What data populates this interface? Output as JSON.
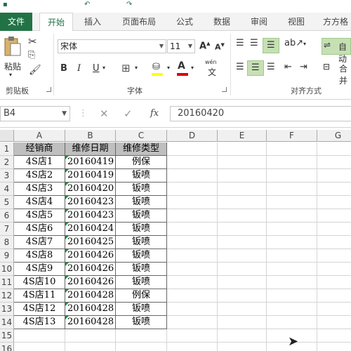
{
  "ribbon_tabs": [
    "文件",
    "开始",
    "插入",
    "页面布局",
    "公式",
    "数据",
    "审阅",
    "视图",
    "方方格"
  ],
  "active_tab": "开始",
  "clipboard": {
    "paste_label": "粘贴",
    "group_label": "剪贴板"
  },
  "font": {
    "family": "宋体",
    "size": "11",
    "group_label": "字体",
    "wen_label": "wén\n文"
  },
  "alignment": {
    "group_label": "对齐方式",
    "wrap_label": "自动",
    "merge_label": "合并"
  },
  "formula_bar": {
    "name_box": "B4",
    "fx_label": "fx",
    "content": "20160420"
  },
  "columns": [
    "A",
    "B",
    "C",
    "D",
    "E",
    "F",
    "G"
  ],
  "rows": [
    "1",
    "2",
    "3",
    "4",
    "5",
    "6",
    "7",
    "8",
    "9",
    "10",
    "11",
    "12",
    "13",
    "14",
    "15",
    "16"
  ],
  "table": {
    "headers": [
      "经销商",
      "维修日期",
      "维修类型"
    ],
    "data": [
      [
        "4S店1",
        "20160419",
        "例保"
      ],
      [
        "4S店2",
        "20160419",
        "钣喷"
      ],
      [
        "4S店3",
        "20160420",
        "钣喷"
      ],
      [
        "4S店4",
        "20160423",
        "钣喷"
      ],
      [
        "4S店5",
        "20160423",
        "钣喷"
      ],
      [
        "4S店6",
        "20160424",
        "钣喷"
      ],
      [
        "4S店7",
        "20160425",
        "钣喷"
      ],
      [
        "4S店8",
        "20160426",
        "钣喷"
      ],
      [
        "4S店9",
        "20160426",
        "钣喷"
      ],
      [
        "4S店10",
        "20160426",
        "钣喷"
      ],
      [
        "4S店11",
        "20160428",
        "例保"
      ],
      [
        "4S店12",
        "20160428",
        "钣喷"
      ],
      [
        "4S店13",
        "20160428",
        "钣喷"
      ]
    ]
  },
  "colors": {
    "excel_green": "#217346",
    "header_fill": "#bfbfbf",
    "font_color_red": "#e00000",
    "highlight_yellow": "#ffff00"
  }
}
